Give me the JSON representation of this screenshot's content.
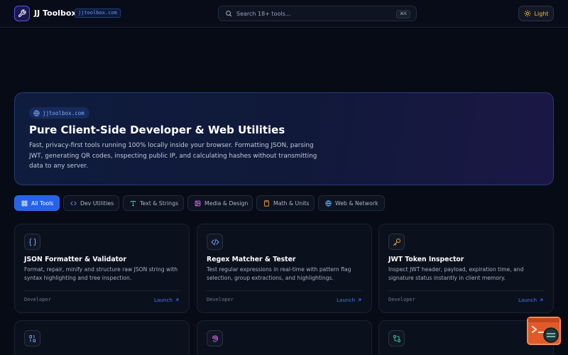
{
  "header": {
    "brand": "JJ Toolbox",
    "domain_badge": "jjtoolbox.com",
    "search_placeholder": "Search 18+ tools...",
    "search_shortcut": "⌘K",
    "theme_toggle_label": "Light"
  },
  "hero": {
    "pill": "jjtoolbox.com",
    "title": "Pure Client-Side Developer & Web Utilities",
    "description": "Fast, privacy-first tools running 100% locally inside your browser. Formatting JSON, parsing JWT, generating QR codes, inspecting public IP, and calculating hashes without transmitting data to any server."
  },
  "tabs": [
    {
      "label": "All Tools",
      "icon": "grid-icon",
      "active": true
    },
    {
      "label": "Dev Utilities",
      "icon": "code-icon",
      "active": false
    },
    {
      "label": "Text & Strings",
      "icon": "type-icon",
      "active": false
    },
    {
      "label": "Media & Design",
      "icon": "image-icon",
      "active": false
    },
    {
      "label": "Math & Units",
      "icon": "calculator-icon",
      "active": false
    },
    {
      "label": "Web & Network",
      "icon": "globe-icon",
      "active": false
    }
  ],
  "cards": [
    {
      "title": "JSON Formatter & Validator",
      "description": "Format, repair, minify and structure raw JSON string with syntax highlighting and tree inspection.",
      "category": "Developer",
      "launch": "Launch",
      "icon": "braces-icon"
    },
    {
      "title": "Regex Matcher & Tester",
      "description": "Test regular expressions in real-time with pattern flag selection, group extractions, and highlightings.",
      "category": "Developer",
      "launch": "Launch",
      "icon": "code-icon"
    },
    {
      "title": "JWT Token Inspector",
      "description": "Inspect JWT header, payload, expiration time, and signature status instantly in client memory.",
      "category": "Developer",
      "launch": "Launch",
      "icon": "key-icon"
    },
    {
      "title": "",
      "icon": "binary-icon"
    },
    {
      "title": "",
      "icon": "fingerprint-icon"
    },
    {
      "title": "",
      "icon": "git-compare-icon"
    }
  ],
  "colors": {
    "background": "#070b16",
    "accent": "#2563eb",
    "hero_border": "#283b78",
    "theme_icon": "#f1c232"
  }
}
